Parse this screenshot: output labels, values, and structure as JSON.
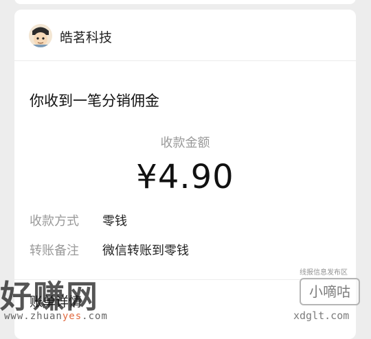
{
  "app": {
    "name": "皓茗科技"
  },
  "notice": {
    "title": "你收到一笔分销佣金",
    "amount_label": "收款金额",
    "amount": "¥4.90"
  },
  "details": [
    {
      "label": "收款方式",
      "value": "零钱"
    },
    {
      "label": "转账备注",
      "value": "微信转账到零钱"
    }
  ],
  "bottom": {
    "text": "账单详情"
  },
  "watermarks": {
    "left_logo": "好赚网",
    "left_url_prefix": "www.zhuan",
    "left_url_highlight": "yes",
    "left_url_suffix": ".com",
    "right_caption": "线报信息发布区",
    "right_logo": "小嘀咕",
    "right_url": "xdglt.com"
  }
}
